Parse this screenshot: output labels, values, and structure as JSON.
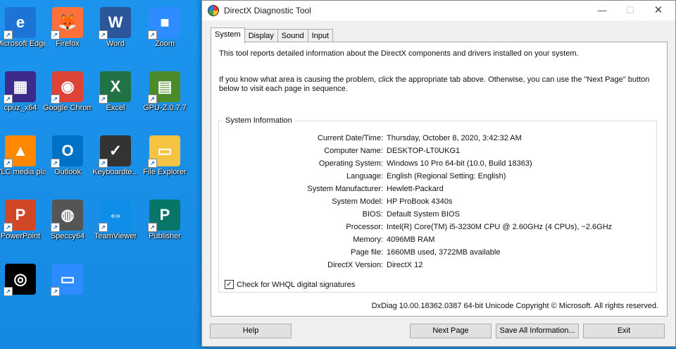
{
  "desktop": {
    "icons": [
      {
        "label": "Microsoft Edge",
        "glyph": "e",
        "color": "#1e73d6"
      },
      {
        "label": "Firefox",
        "glyph": "🦊",
        "color": "#ff7139"
      },
      {
        "label": "Word",
        "glyph": "W",
        "color": "#2b579a"
      },
      {
        "label": "Zoom",
        "glyph": "■",
        "color": "#2d8cff"
      },
      {
        "label": "cpuz_x64",
        "glyph": "▦",
        "color": "#3d2b8c"
      },
      {
        "label": "Google Chrome",
        "glyph": "◉",
        "color": "#db4437"
      },
      {
        "label": "Excel",
        "glyph": "X",
        "color": "#217346"
      },
      {
        "label": "GPU-Z.0.7.7",
        "glyph": "▤",
        "color": "#4c8b2b"
      },
      {
        "label": "VLC media player",
        "glyph": "▲",
        "color": "#ff8800"
      },
      {
        "label": "Outlook",
        "glyph": "O",
        "color": "#0072c6"
      },
      {
        "label": "Keyboardte...",
        "glyph": "✓",
        "color": "#333333"
      },
      {
        "label": "File Explorer",
        "glyph": "▭",
        "color": "#f5c242"
      },
      {
        "label": "PowerPoint",
        "glyph": "P",
        "color": "#d24726"
      },
      {
        "label": "Speccy64",
        "glyph": "◍",
        "color": "#555555"
      },
      {
        "label": "TeamViewer",
        "glyph": "⇔",
        "color": "#0e8ee9"
      },
      {
        "label": "Publisher",
        "glyph": "P",
        "color": "#077568"
      },
      {
        "label": "",
        "glyph": "◎",
        "color": "#000000"
      },
      {
        "label": "",
        "glyph": "▭",
        "color": "#2d8cff"
      }
    ]
  },
  "window": {
    "title": "DirectX Diagnostic Tool",
    "controls": {
      "minimize": "—",
      "maximize": "☐",
      "close": "✕"
    },
    "tabs": [
      "System",
      "Display",
      "Sound",
      "Input"
    ],
    "active_tab": "System",
    "intro": "This tool reports detailed information about the DirectX components and drivers installed on your system.",
    "intro2": "If you know what area is causing the problem, click the appropriate tab above.  Otherwise, you can use the \"Next Page\" button below to visit each page in sequence.",
    "sysinfo_title": "System Information",
    "sysinfo": [
      {
        "k": "Current Date/Time:",
        "v": "Thursday, October 8, 2020, 3:42:32 AM"
      },
      {
        "k": "Computer Name:",
        "v": "DESKTOP-LT0UKG1"
      },
      {
        "k": "Operating System:",
        "v": "Windows 10 Pro 64-bit (10.0, Build 18363)"
      },
      {
        "k": "Language:",
        "v": "English (Regional Setting: English)"
      },
      {
        "k": "System Manufacturer:",
        "v": "Hewlett-Packard"
      },
      {
        "k": "System Model:",
        "v": "HP ProBook 4340s"
      },
      {
        "k": "BIOS:",
        "v": "Default System BIOS"
      },
      {
        "k": "Processor:",
        "v": "Intel(R) Core(TM) i5-3230M CPU @ 2.60GHz (4 CPUs), ~2.6GHz"
      },
      {
        "k": "Memory:",
        "v": "4096MB RAM"
      },
      {
        "k": "Page file:",
        "v": "1660MB used, 3722MB available"
      },
      {
        "k": "DirectX Version:",
        "v": "DirectX 12"
      }
    ],
    "whql_label": "Check for WHQL digital signatures",
    "whql_checked": true,
    "copyright": "DxDiag 10.00.18362.0387 64-bit Unicode  Copyright © Microsoft. All rights reserved.",
    "buttons": {
      "help": "Help",
      "next_page": "Next Page",
      "save_all": "Save All Information...",
      "exit": "Exit"
    }
  }
}
